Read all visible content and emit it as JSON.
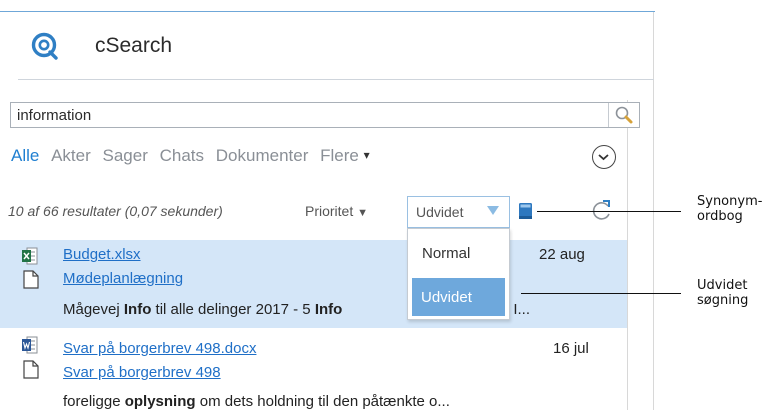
{
  "app": {
    "title": "cSearch"
  },
  "search": {
    "value": "information"
  },
  "tabs": [
    "Alle",
    "Akter",
    "Sager",
    "Chats",
    "Dokumenter"
  ],
  "tabs_more": "Flere",
  "results_info": "10 af 66 resultater (0,07 sekunder)",
  "priority_label": "Prioritet",
  "mode": {
    "selected": "Udvidet",
    "options": [
      "Normal",
      "Udvidet"
    ]
  },
  "results": [
    {
      "file": "Budget.xlsx",
      "case": "Mødeplanlægning",
      "date": "22 aug",
      "snippet_parts": [
        [
          "Mågevej ",
          false
        ],
        [
          "Info",
          true
        ],
        [
          " til alle delinger 2017 - 5 ",
          false
        ],
        [
          "Info",
          true
        ]
      ],
      "snippet_tail": "t I...",
      "file_type": "excel"
    },
    {
      "file": "Svar på borgerbrev 498.docx",
      "case": "Svar på borgerbrev 498",
      "date": "16 jul",
      "snippet_parts": [
        [
          "foreligge ",
          false
        ],
        [
          "oplysning",
          true
        ],
        [
          " om dets holdning til den påtænkte o...",
          false
        ]
      ],
      "snippet_tail": "",
      "file_type": "word"
    }
  ],
  "callouts": {
    "synonym": "Synonym-\nordbog",
    "udvidet": "Udvidet\nsøgning"
  },
  "colors": {
    "accent": "#1f7fd1",
    "highlight_row": "#d4e6f8",
    "selected_option": "#6ea8dc"
  }
}
